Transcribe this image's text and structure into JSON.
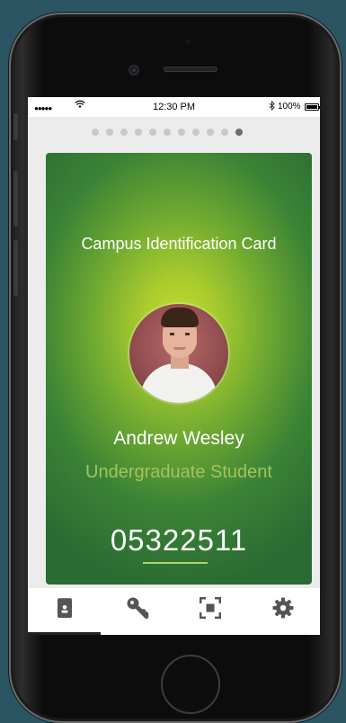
{
  "status_bar": {
    "signal": "●●●●●",
    "time": "12:30 PM",
    "battery_text": "100%"
  },
  "page_indicator": {
    "total": 11,
    "active_index": 10
  },
  "card": {
    "title": "Campus Identification Card",
    "name": "Andrew Wesley",
    "role": "Undergraduate Student",
    "id_number": "05322511"
  },
  "tab_bar": {
    "active": "id-card",
    "items": [
      {
        "icon": "id-card-icon"
      },
      {
        "icon": "key-icon"
      },
      {
        "icon": "scan-icon"
      },
      {
        "icon": "gear-icon"
      }
    ]
  },
  "colors": {
    "background": "#2b5563",
    "card_center": "#c5dc30",
    "card_edge": "#2a6a33",
    "role_text": "#a3c25e",
    "tab_icon": "#555555"
  }
}
